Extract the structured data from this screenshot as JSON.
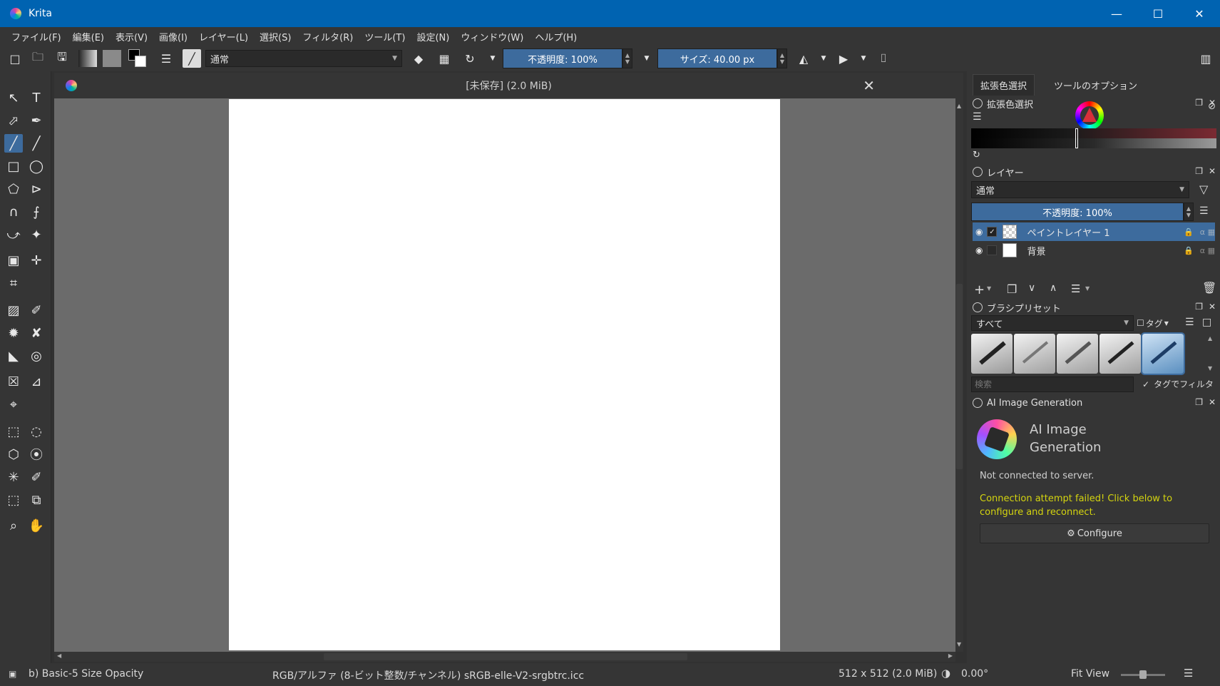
{
  "window": {
    "title": "Krita"
  },
  "menu": [
    "ファイル(F)",
    "編集(E)",
    "表示(V)",
    "画像(I)",
    "レイヤー(L)",
    "選択(S)",
    "フィルタ(R)",
    "ツール(T)",
    "設定(N)",
    "ウィンドウ(W)",
    "ヘルプ(H)"
  ],
  "toolbar": {
    "blend_mode": "通常",
    "opacity": "不透明度: 100%",
    "size": "サイズ: 40.00 px"
  },
  "document": {
    "tab_title": "[未保存]  (2.0 MiB)"
  },
  "dock": {
    "tabs": [
      "拡張色選択",
      "ツールのオプション"
    ],
    "color_panel": {
      "title": "拡張色選択"
    },
    "layers_panel": {
      "title": "レイヤー",
      "blend_mode": "通常",
      "opacity": "不透明度:  100%",
      "layers": [
        {
          "name": "ペイントレイヤー 1",
          "visible": true,
          "selected": true
        },
        {
          "name": "背景",
          "visible": true,
          "selected": false
        }
      ]
    },
    "brush_panel": {
      "title": "ブラシプリセット",
      "filter": "すべて",
      "tag": "タグ",
      "search_placeholder": "検索",
      "tag_filter": "タグでフィルタ"
    },
    "ai_panel": {
      "title": "AI Image Generation",
      "heading": "AI Image Generation",
      "status": "Not connected to server.",
      "error": "Connection attempt failed! Click below to configure and reconnect.",
      "configure": "Configure",
      "error_color": "#d4d40f"
    }
  },
  "statusbar": {
    "brush": "b) Basic-5 Size Opacity",
    "color_info": "RGB/アルファ (8-ビット整数/チャンネル)  sRGB-elle-V2-srgbtrc.icc",
    "image_size": "512 x 512 (2.0 MiB)",
    "rotation": "0.00°",
    "zoom": "Fit View"
  },
  "colors": {
    "accent": "#3d6b9d",
    "titlebar": "#0063b1",
    "canvas_bg": "#6b6b6b"
  }
}
